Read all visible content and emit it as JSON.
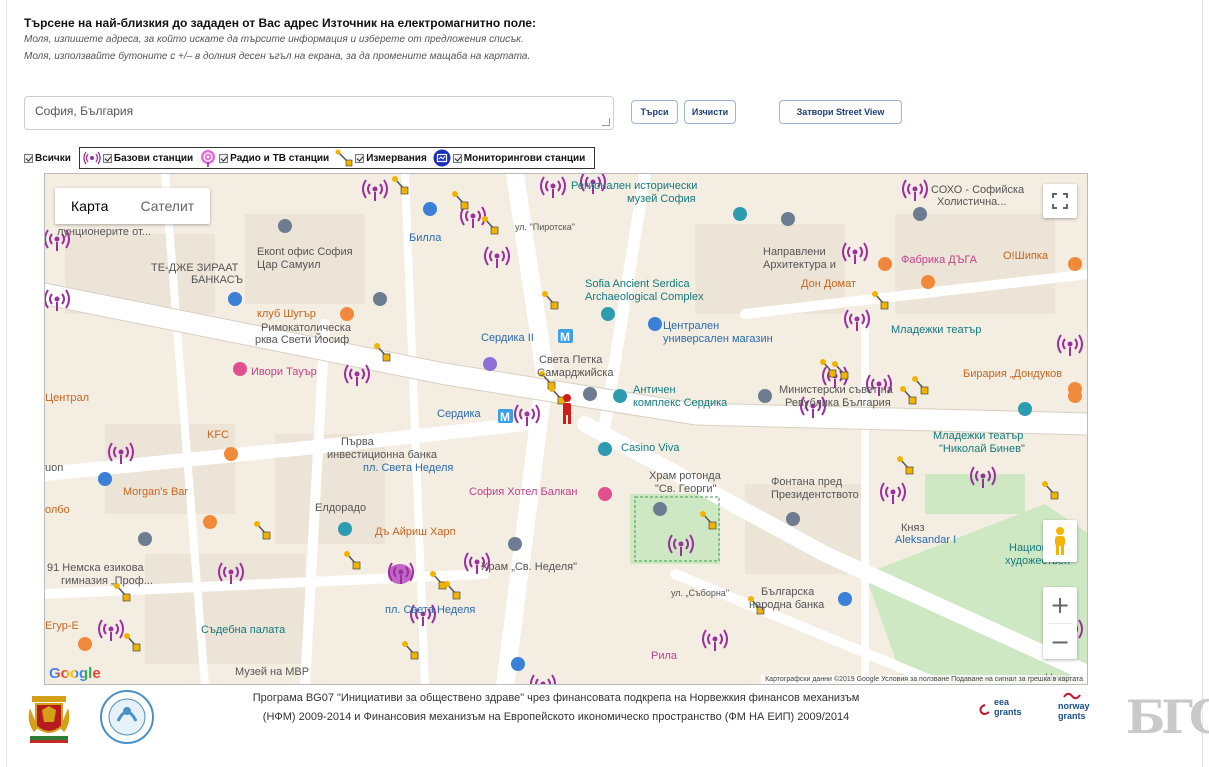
{
  "header": {
    "title": "Търсене на най-близкия до зададен от Вас адрес Източник на електромагнитно поле:",
    "hint1": "Моля, изпишете адреса, за който искате да търсите информация и изберете от предложения списък.",
    "hint2": "Моля, използвайте бутоните с +/– в долния десен ъгъл на екрана, за да промените мащаба на картата."
  },
  "search": {
    "value": "София, България",
    "search_label": "Търси",
    "clear_label": "Изчисти",
    "close_streetview_label": "Затвори Street View"
  },
  "filters": {
    "all": "Всички",
    "base_stations": "Базови станции",
    "radio_tv": "Радио и ТВ станции",
    "measurements": "Измервания",
    "monitoring": "Мониторингови станции"
  },
  "map": {
    "type_map": "Карта",
    "type_satellite": "Сателит",
    "google": "Google",
    "attribution": "Картографски данни ©2019 Google   Условия за ползване   Подаване на сигнал за грешка в картата",
    "zoom_in": "+",
    "zoom_out": "−",
    "labels": {
      "l1": "Регионален исторически",
      "l2": "музей София",
      "l3": "СОХО - Софийска",
      "l4": "Холистична...",
      "l5": "Екont офис София",
      "l6": "Цар Самуил",
      "l7": "ТЕ-ДЖЕ ЗИРААТ",
      "l8": "БАНКАСЪ",
      "l9": "Билла",
      "l10": "ул. \"Пиротска\"",
      "l11": "Направлени",
      "l12": "Архитектура и",
      "l13": "Фабрика ДЪГА",
      "l14": "O!Шипка",
      "l15": "Дон Домат",
      "l16": "Sofia Ancient Serdica",
      "l17": "Archaeological Complex",
      "l18": "клуб Шугър",
      "l19": "Римокатолическа",
      "l20": "рква Свети Йосиф",
      "l21": "Сердика II",
      "l22": "Централен",
      "l23": "универсален магазин",
      "l24": "Младежки театър",
      "l25": "Ивори Тауър",
      "l26": "Света Петка",
      "l27": "Самарджийска",
      "l28": "Античен",
      "l29": "комплекс Сердика",
      "l30": "Министерски съвет на",
      "l31": "Република България",
      "l32": "Бирария „Дондуков",
      "l33": "Сердика",
      "l34": "Casino Viva",
      "l35": "KFC",
      "l36": "Първа",
      "l37": "инвестиционна банка",
      "l38": "пл. Света Неделя",
      "l39": "Младежки театър",
      "l40": "\"Николай Бинев\"",
      "l41": "Morgan's Bar",
      "l42": "София Хотел Балкан",
      "l43": "Храм ротонда",
      "l44": "\"Св. Георги\"",
      "l45": "Фонтана пред",
      "l46": "Президентството",
      "l47": "Елдорадо",
      "l48": "Дъ Айриш Харп",
      "l49": "Княз",
      "l50": "Aleksandar I",
      "l51": "91 Немска езикова",
      "l52": "гимназия „Проф...",
      "l53": "Храм „Св. Неделя\"",
      "l54": "ул. „Съборна\"",
      "l55": "Българска",
      "l56": "народна банка",
      "l57": "Съдебна палата",
      "l58": "пл. Света Неделя",
      "l59": "Музей на МВР",
      "l60": "Рила",
      "l61": "Егур-Е",
      "l62": "Централ",
      "l63": "Национа",
      "l64": "художествен",
      "l65": "Нико",
      "l66": "лунционерите от...",
      "l67": "олбо",
      "l68": "uon"
    }
  },
  "footer": {
    "line1": "Програма BG07 \"Инициативи за обществено здраве\" чрез финансовата подкрепа на Норвежкия финансов механизъм",
    "line2": "(НФМ) 2009-2014 и Финансовия механизъм на Европейското икономическо пространство (ФМ НА ЕИП) 2009/2014",
    "eea_top": "eea",
    "eea_bottom": "grants",
    "norway_top": "norway",
    "norway_bottom": "grants",
    "bgo": "БГО"
  }
}
